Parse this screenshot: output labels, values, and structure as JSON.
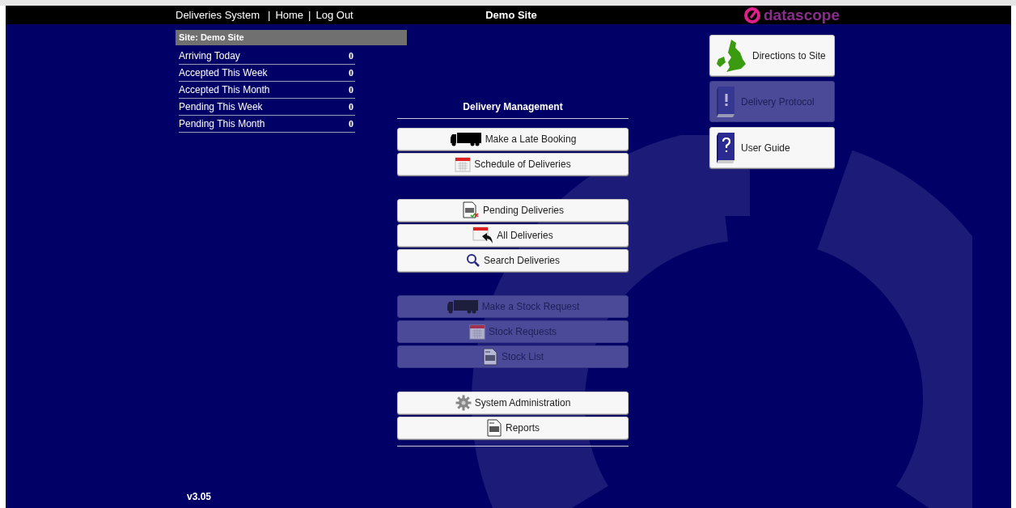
{
  "header": {
    "app_title": "Deliveries System",
    "separators": [
      "|",
      "|"
    ],
    "links": [
      "Home",
      "Log Out"
    ],
    "site_title": "Demo Site",
    "logo_text": "datascope"
  },
  "summary": {
    "title": "Site: Demo Site",
    "rows": [
      {
        "label": "Arriving Today",
        "value": "0"
      },
      {
        "label": "Accepted This Week",
        "value": "0"
      },
      {
        "label": "Accepted This Month",
        "value": "0"
      },
      {
        "label": "Pending This Week",
        "value": "0"
      },
      {
        "label": "Pending This Month",
        "value": "0"
      }
    ]
  },
  "menu": {
    "title": "Delivery Management",
    "groups": [
      [
        {
          "label": "Make a Late Booking",
          "kind": "truck",
          "disabled": false
        },
        {
          "label": "Schedule of Deliveries",
          "kind": "calendar",
          "disabled": false
        }
      ],
      [
        {
          "label": "Pending Deliveries",
          "kind": "review",
          "disabled": false
        },
        {
          "label": "All Deliveries",
          "kind": "history",
          "disabled": false
        },
        {
          "label": "Search Deliveries",
          "kind": "search",
          "disabled": false
        }
      ],
      [
        {
          "label": "Make a Stock Request",
          "kind": "truck",
          "disabled": true
        },
        {
          "label": "Stock Requests",
          "kind": "calendar",
          "disabled": true
        },
        {
          "label": "Stock List",
          "kind": "document",
          "disabled": true
        }
      ],
      [
        {
          "label": "System Administration",
          "kind": "settings",
          "disabled": false
        },
        {
          "label": "Reports",
          "kind": "document",
          "disabled": false
        }
      ]
    ]
  },
  "side_buttons": [
    {
      "label": "Directions to Site",
      "kind": "map",
      "disabled": false
    },
    {
      "label": "Delivery Protocol",
      "kind": "protocol",
      "disabled": true
    },
    {
      "label": "User Guide",
      "kind": "guide",
      "disabled": false
    }
  ],
  "version": "v3.05"
}
